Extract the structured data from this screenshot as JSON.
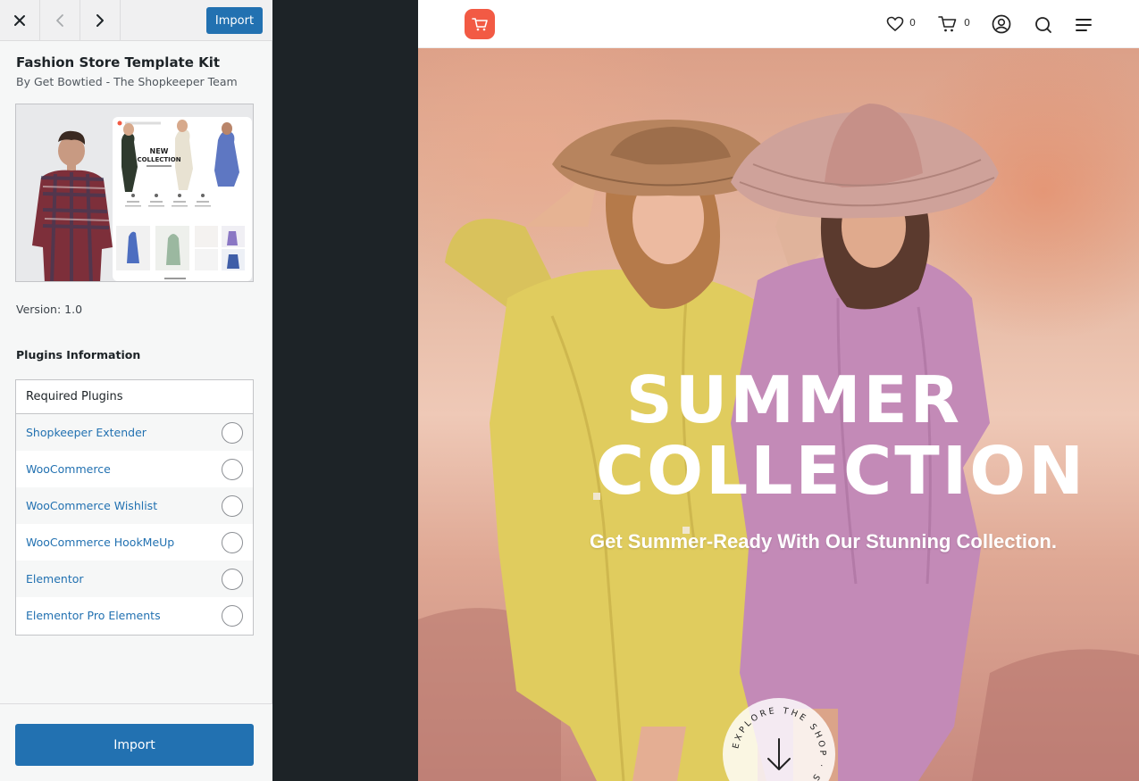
{
  "toolbar": {
    "close_icon": "close-icon",
    "back_icon": "chevron-left-icon",
    "forward_icon": "chevron-right-icon",
    "import_label": "Import"
  },
  "kit": {
    "title": "Fashion Store Template Kit",
    "author": "By Get Bowtied - The Shopkeeper Team",
    "version": "Version: 1.0",
    "thumbnail": {
      "heading_line1": "NEW",
      "heading_line2": "COLLECTION"
    }
  },
  "plugins": {
    "heading": "Plugins Information",
    "table_header": "Required Plugins",
    "items": [
      {
        "label": "Shopkeeper Extender",
        "installed": false
      },
      {
        "label": "WooCommerce",
        "installed": false
      },
      {
        "label": "WooCommerce Wishlist",
        "installed": false
      },
      {
        "label": "WooCommerce HookMeUp",
        "installed": false
      },
      {
        "label": "Elementor",
        "installed": false
      },
      {
        "label": "Elementor Pro Elements",
        "installed": false
      }
    ]
  },
  "footer": {
    "import_label": "Import"
  },
  "preview": {
    "header": {
      "logo_icon": "shopping-cart-logo-icon",
      "wishlist_count": "0",
      "cart_count": "0",
      "icons": [
        "heart-icon",
        "cart-icon",
        "account-icon",
        "search-icon",
        "menu-icon"
      ]
    },
    "hero": {
      "title_line1": "SUMMER",
      "title_line2": "COLLECTION",
      "subtitle": "Get Summer-Ready With Our Stunning Collection.",
      "badge_text": "EXPLORE THE SHOP · SCROLL ·",
      "badge_icon": "arrow-down-icon"
    }
  },
  "colors": {
    "accent": "#2271b1",
    "logo": "#f25a44",
    "panel_bg": "#f6f7f7",
    "dark_gutter": "#1d2327"
  }
}
